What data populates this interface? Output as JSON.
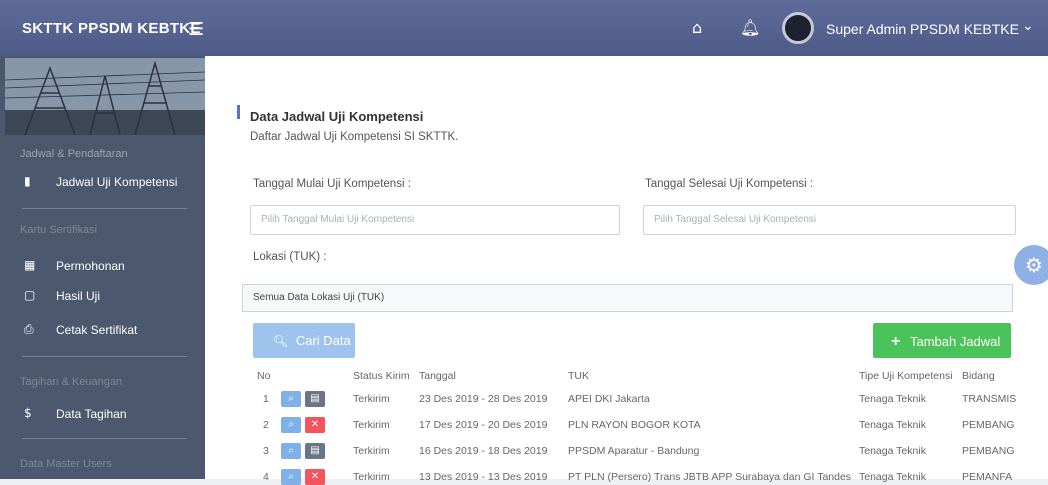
{
  "topbar": {
    "brand": "SKTTK PPSDM KEBTKE",
    "menu_icon": "hamburger-icon",
    "home_icon": "home-icon",
    "bell_icon": "bell-icon",
    "user_name": "Super Admin PPSDM KEBTKE",
    "caret_icon": "chevron-down-icon"
  },
  "sidebar": {
    "sections": [
      {
        "label": "Jadwal & Pendaftaran"
      },
      {
        "label": "Kartu Sertifikasi"
      },
      {
        "label": "Tagihan & Keuangan"
      },
      {
        "label": "Data Master Users"
      }
    ],
    "items": [
      {
        "label": "Jadwal Uji Kompetensi",
        "icon": "document-icon"
      },
      {
        "label": "Permohonan",
        "icon": "id-card-icon"
      },
      {
        "label": "Hasil Uji",
        "icon": "monitor-icon"
      },
      {
        "label": "Cetak Sertifikat",
        "icon": "print-icon"
      },
      {
        "label": "Data Tagihan",
        "icon": "dollar-icon"
      }
    ]
  },
  "page": {
    "title": "Data Jadwal Uji Kompetensi",
    "subtitle": "Daftar Jadwal Uji Kompetensi SI SKTTK."
  },
  "filters": {
    "start_label": "Tanggal Mulai Uji Kompetensi :",
    "start_placeholder": "Pilih Tanggal Mulai Uji Kompetensi",
    "end_label": "Tanggal Selesai Uji Kompetensi :",
    "end_placeholder": "Pilih Tanggal Selesai Uji Kompetensi",
    "location_label": "Lokasi (TUK) :",
    "location_value": "Semua Data Lokasi Uji (TUK)"
  },
  "actions": {
    "search_label": "Cari Data",
    "search_icon": "search-icon",
    "add_label": "Tambah Jadwal",
    "add_icon": "plus-icon"
  },
  "table": {
    "headers": [
      "No",
      "Status Kirim",
      "Tanggal",
      "TUK",
      "Tipe Uji Kompetensi",
      "Bidang"
    ],
    "rows": [
      {
        "no": "1",
        "status": "Terkirim",
        "tanggal": "23 Des 2019 - 28 Des 2019",
        "tuk": "APEI DKI Jakarta",
        "tipe": "Tenaga Teknik",
        "bidang": "TRANSMIS"
      },
      {
        "no": "2",
        "status": "Terkirim",
        "tanggal": "17 Des 2019 - 20 Des 2019",
        "tuk": "PLN RAYON BOGOR KOTA",
        "tipe": "Tenaga Teknik",
        "bidang": "PEMBANG"
      },
      {
        "no": "3",
        "status": "Terkirim",
        "tanggal": "16 Des 2019 - 18 Des 2019",
        "tuk": "PPSDM Aparatur - Bandung",
        "tipe": "Tenaga Teknik",
        "bidang": "PEMBANG"
      },
      {
        "no": "4",
        "status": "Terkirim",
        "tanggal": "13 Des 2019 - 13 Des 2019",
        "tuk": "PT PLN (Persero) Trans JBTB APP Surabaya dan GI Tandes",
        "tipe": "Tenaga Teknik",
        "bidang": "PEMANFA"
      }
    ]
  },
  "colors": {
    "topbar": "#56628f",
    "sidebar": "#4b586d",
    "search_button": "#9ec3ec",
    "add_button": "#4cc25a",
    "view_button": "#7fb0ea",
    "delete_button": "#f2555d",
    "gear_button": "#8fb0e6"
  }
}
